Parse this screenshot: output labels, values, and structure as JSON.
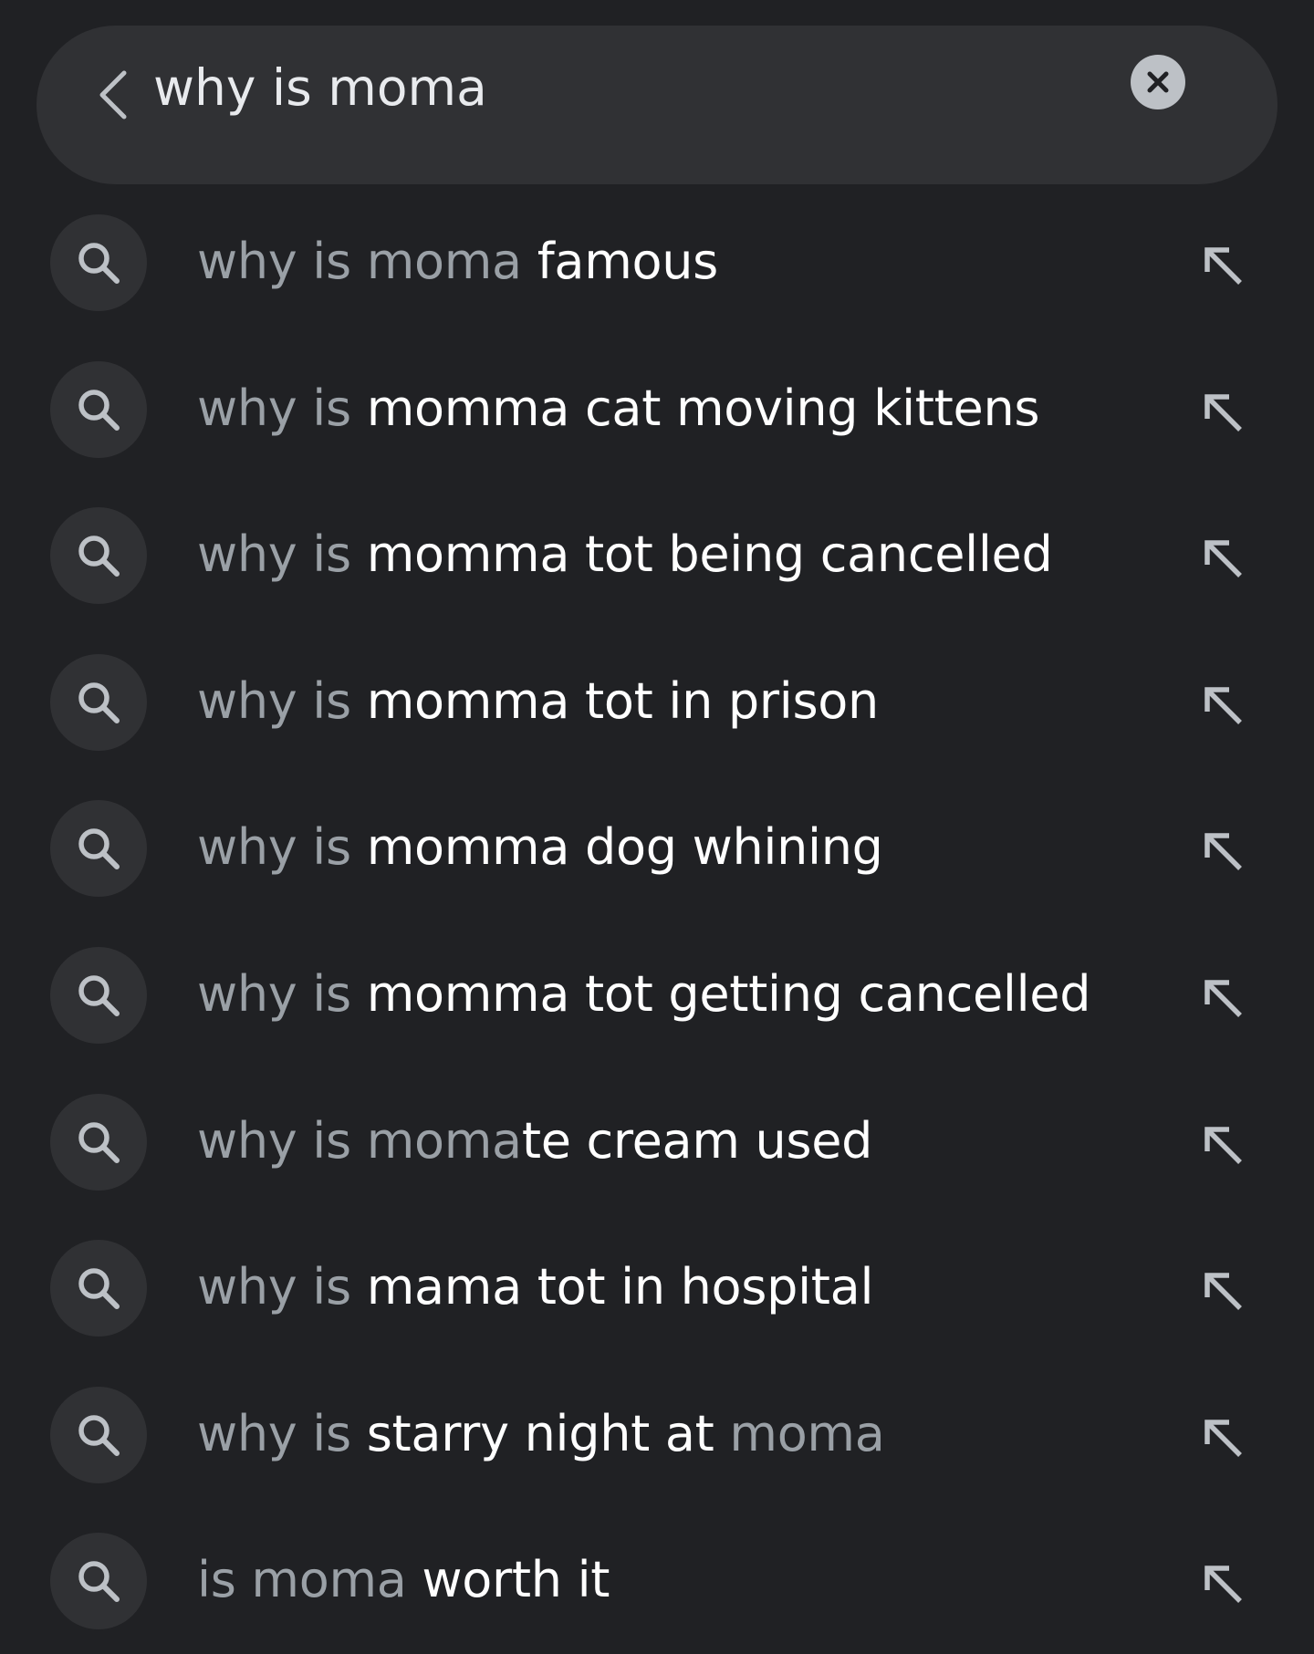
{
  "search": {
    "value": "why is moma",
    "back_icon": "chevron-left-icon",
    "clear_icon": "close-icon"
  },
  "suggestions": [
    {
      "parts": [
        {
          "text": "why is moma ",
          "style": "dim"
        },
        {
          "text": "famous",
          "style": "bright"
        }
      ]
    },
    {
      "parts": [
        {
          "text": "why is ",
          "style": "dim"
        },
        {
          "text": "momma cat moving kittens",
          "style": "bright"
        }
      ]
    },
    {
      "parts": [
        {
          "text": "why is ",
          "style": "dim"
        },
        {
          "text": "momma tot being cancelled",
          "style": "bright"
        }
      ]
    },
    {
      "parts": [
        {
          "text": "why is ",
          "style": "dim"
        },
        {
          "text": "momma tot in prison",
          "style": "bright"
        }
      ]
    },
    {
      "parts": [
        {
          "text": "why is ",
          "style": "dim"
        },
        {
          "text": "momma dog whining",
          "style": "bright"
        }
      ]
    },
    {
      "parts": [
        {
          "text": "why is ",
          "style": "dim"
        },
        {
          "text": "momma tot getting cancelled",
          "style": "bright"
        }
      ]
    },
    {
      "parts": [
        {
          "text": "why is moma",
          "style": "dim"
        },
        {
          "text": "te cream used",
          "style": "bright"
        }
      ]
    },
    {
      "parts": [
        {
          "text": "why is ",
          "style": "dim"
        },
        {
          "text": "mama tot in hospital",
          "style": "bright"
        }
      ]
    },
    {
      "parts": [
        {
          "text": "why is ",
          "style": "dim"
        },
        {
          "text": "starry night at ",
          "style": "bright"
        },
        {
          "text": "moma",
          "style": "dim"
        }
      ]
    },
    {
      "parts": [
        {
          "text": "is moma ",
          "style": "dim"
        },
        {
          "text": "worth it",
          "style": "bright"
        }
      ]
    }
  ],
  "icons": {
    "suggestion_icon": "search-icon",
    "fill_icon": "arrow-up-left-icon"
  },
  "colors": {
    "background": "#202124",
    "surface": "#303134",
    "text_bright": "#ffffff",
    "text_dim": "#9aa0a6",
    "icon": "#bdc1c6"
  }
}
